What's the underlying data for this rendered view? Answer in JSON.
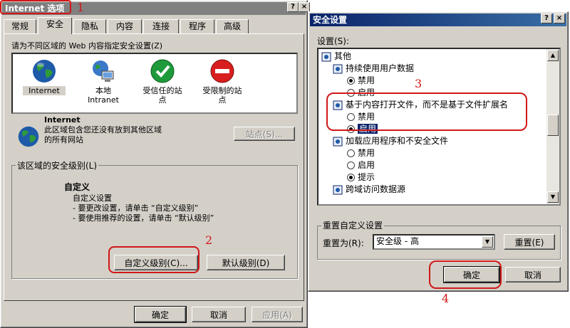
{
  "ie_window": {
    "title": "Internet 选项",
    "title_buttons": [
      "?",
      "×"
    ],
    "tabs": [
      "常规",
      "安全",
      "隐私",
      "内容",
      "连接",
      "程序",
      "高级"
    ],
    "zone_prompt": "请为不同区域的 Web 内容指定安全设置(Z)",
    "zones": [
      {
        "label": "Internet",
        "icon": "globe-icon"
      },
      {
        "label": "本地\nIntranet",
        "icon": "intranet-icon"
      },
      {
        "label": "受信任的站\n点",
        "icon": "trusted-sites-icon"
      },
      {
        "label": "受限制的站\n点",
        "icon": "restricted-sites-icon"
      }
    ],
    "zone_info_title": "Internet",
    "zone_info_desc": "此区域包含您还没有放到其他区域\n的所有网站",
    "sites_button": "站点(S)...",
    "security_level_group": "该区域的安全级别(L)",
    "custom_title": "自定义",
    "custom_lines": [
      "自定义设置",
      "- 要更改设置，请单击 “自定义级别”",
      "- 要使用推荐的设置，请单击 “默认级别”"
    ],
    "custom_level_button": "自定义级别(C)...",
    "default_level_button": "默认级别(D)",
    "ok_button": "确定",
    "cancel_button": "取消",
    "apply_button": "应用(A)"
  },
  "security_window": {
    "title": "安全设置",
    "title_buttons": [
      "?",
      "×"
    ],
    "settings_label": "设置(S):",
    "items": [
      {
        "type": "header",
        "text": "其他"
      },
      {
        "type": "setting",
        "text": "持续使用用户数据"
      },
      {
        "type": "radio",
        "text": "禁用",
        "checked": true
      },
      {
        "type": "radio",
        "text": "启用",
        "checked": false
      },
      {
        "type": "setting",
        "text": "基于内容打开文件，而不是基于文件扩展名"
      },
      {
        "type": "radio",
        "text": "禁用",
        "checked": false
      },
      {
        "type": "radio",
        "text": "启用",
        "checked": true
      },
      {
        "type": "setting",
        "text": "加载应用程序和不安全文件"
      },
      {
        "type": "radio",
        "text": "禁用",
        "checked": false
      },
      {
        "type": "radio",
        "text": "启用",
        "checked": false
      },
      {
        "type": "radio",
        "text": "提示",
        "checked": true
      },
      {
        "type": "setting",
        "text": "跨域访问数据源"
      }
    ],
    "reset_group": "重置自定义设置",
    "reset_to_label": "重置为(R):",
    "reset_to_value": "安全级 - 高",
    "reset_button": "重置(E)",
    "ok_button": "确定",
    "cancel_button": "取消"
  },
  "annotations": [
    "1",
    "2",
    "3",
    "4"
  ],
  "colors": {
    "annotation_red": "#d01818",
    "active_title": "#0a246a",
    "inactive_title": "#808080"
  }
}
